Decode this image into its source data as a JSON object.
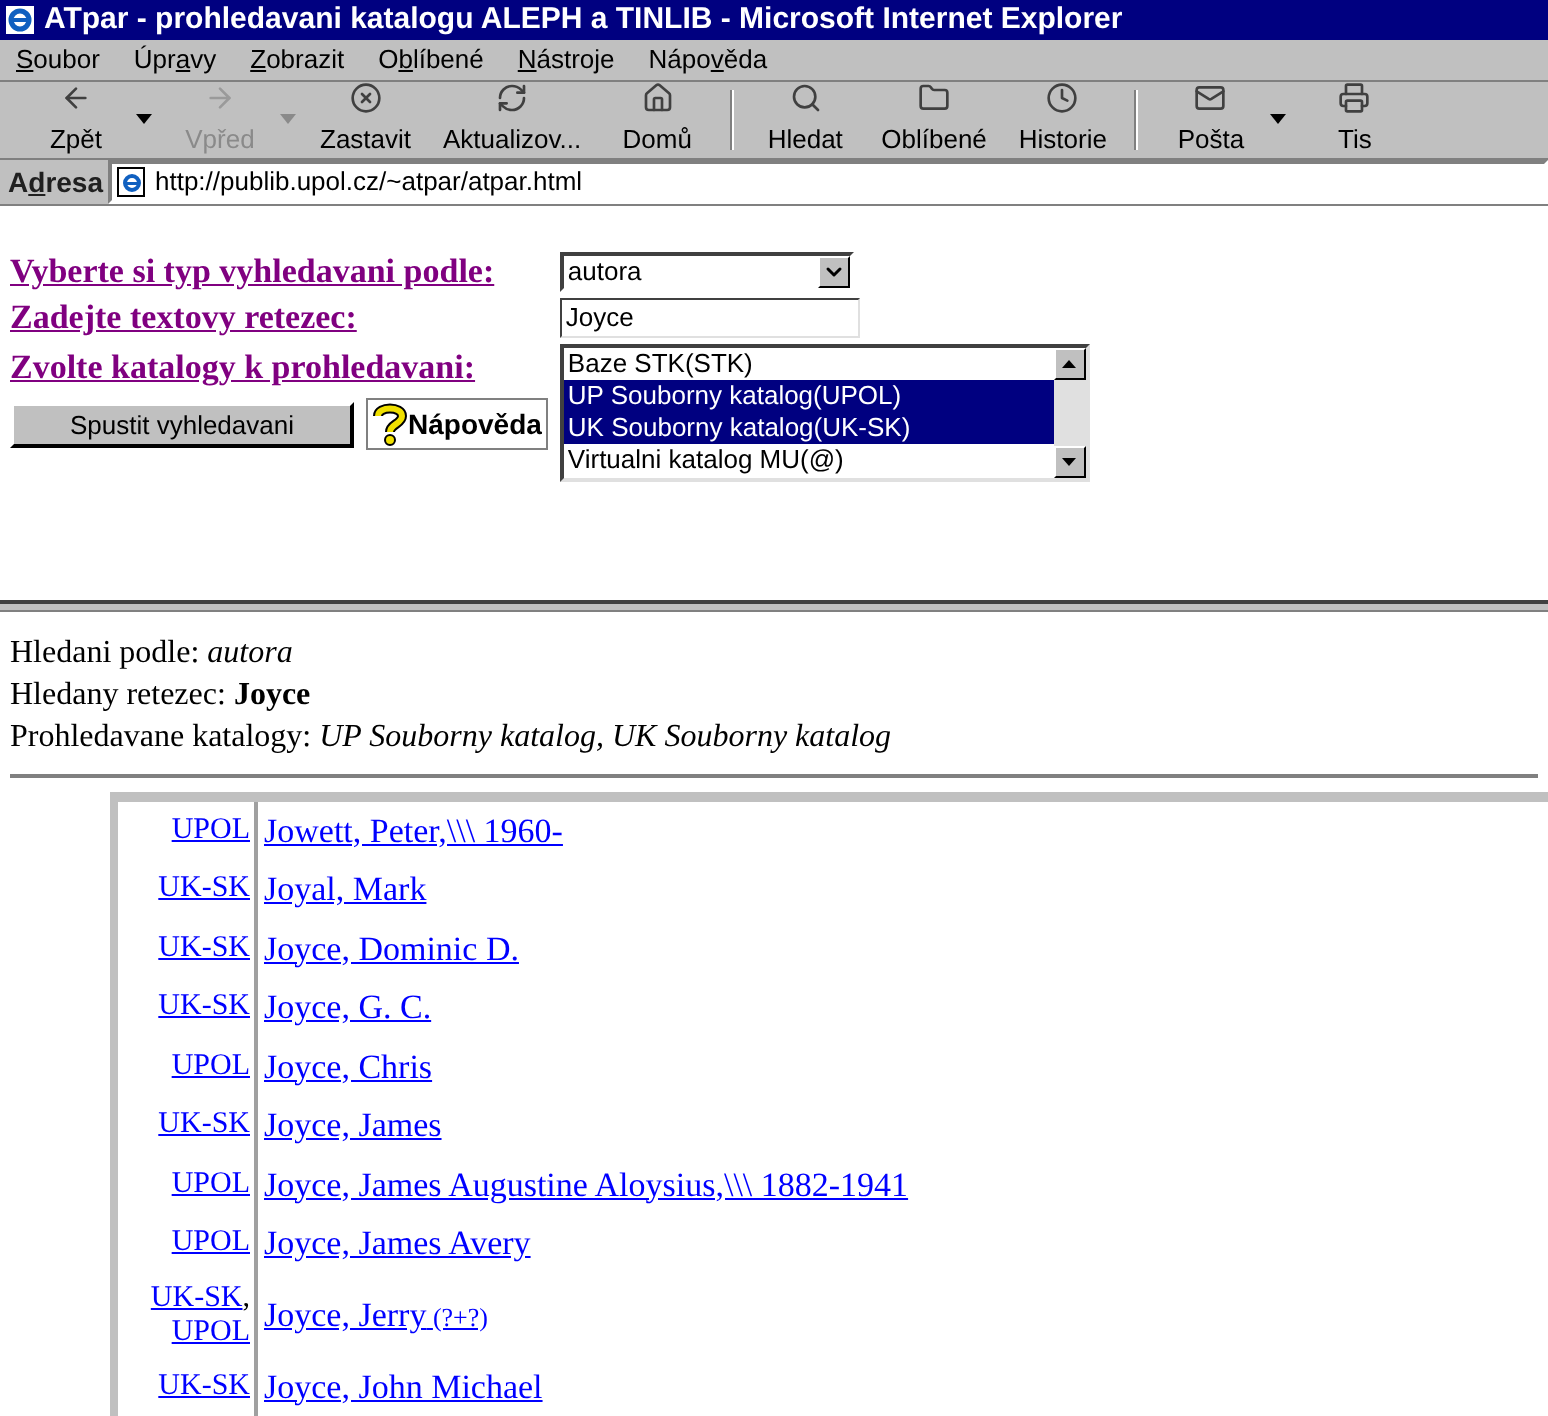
{
  "window": {
    "title": "ATpar - prohledavani katalogu ALEPH a TINLIB - Microsoft Internet Explorer"
  },
  "menu": [
    {
      "label": "Soubor"
    },
    {
      "label": "Úpravy"
    },
    {
      "label": "Zobrazit"
    },
    {
      "label": "Oblíbené"
    },
    {
      "label": "Nástroje"
    },
    {
      "label": "Nápověda"
    }
  ],
  "toolbar": [
    {
      "kind": "back",
      "label": "Zpět",
      "disabled": false,
      "dropdown": true
    },
    {
      "kind": "forward",
      "label": "Vpřed",
      "disabled": true,
      "dropdown": true
    },
    {
      "kind": "stop",
      "label": "Zastavit",
      "disabled": false,
      "dropdown": false
    },
    {
      "kind": "refresh",
      "label": "Aktualizov...",
      "disabled": false,
      "dropdown": false
    },
    {
      "kind": "home",
      "label": "Domů",
      "disabled": false,
      "dropdown": false
    },
    {
      "kind": "separator"
    },
    {
      "kind": "search",
      "label": "Hledat",
      "disabled": false,
      "dropdown": false
    },
    {
      "kind": "favorites",
      "label": "Oblíbené",
      "disabled": false,
      "dropdown": false
    },
    {
      "kind": "history",
      "label": "Historie",
      "disabled": false,
      "dropdown": false
    },
    {
      "kind": "separator"
    },
    {
      "kind": "mail",
      "label": "Pošta",
      "disabled": false,
      "dropdown": true
    },
    {
      "kind": "print",
      "label": "Tis",
      "disabled": false,
      "dropdown": false
    }
  ],
  "address_bar": {
    "label": "Adresa",
    "value": "http://publib.upol.cz/~atpar/atpar.html"
  },
  "form": {
    "search_type_label": "Vyberte si typ vyhledavani podle:",
    "search_type_value": "autora",
    "text_label": "Zadejte textovy retezec:",
    "text_value": "Joyce",
    "catalogs_label": "Zvolte katalogy k prohledavani:",
    "catalogs": [
      {
        "label": "Baze STK(STK)",
        "selected": false
      },
      {
        "label": "UP Souborny katalog(UPOL)",
        "selected": true
      },
      {
        "label": "UK Souborny katalog(UK-SK)",
        "selected": true
      },
      {
        "label": "Virtualni katalog MU(@)",
        "selected": false
      }
    ],
    "submit_button": "Spustit vyhledavani",
    "help_button": "Nápověda"
  },
  "summary": [
    {
      "label": "Hledani podle:",
      "value": "autora"
    },
    {
      "label": "Hledany retezec:",
      "value": "Joyce"
    },
    {
      "label": "Prohledavane katalogy:",
      "value": "UP Souborny katalog, UK Souborny katalog"
    }
  ],
  "results": [
    {
      "catalogs": [
        "UPOL"
      ],
      "name": "Jowett, Peter,\\\\\\ 1960-"
    },
    {
      "catalogs": [
        "UK-SK"
      ],
      "name": "Joyal, Mark"
    },
    {
      "catalogs": [
        "UK-SK"
      ],
      "name": "Joyce, Dominic D."
    },
    {
      "catalogs": [
        "UK-SK"
      ],
      "name": "Joyce, G. C."
    },
    {
      "catalogs": [
        "UPOL"
      ],
      "name": "Joyce, Chris"
    },
    {
      "catalogs": [
        "UK-SK"
      ],
      "name": "Joyce, James"
    },
    {
      "catalogs": [
        "UPOL"
      ],
      "name": "Joyce, James Augustine Aloysius,\\\\\\ 1882-1941"
    },
    {
      "catalogs": [
        "UPOL"
      ],
      "name": "Joyce, James Avery"
    },
    {
      "catalogs": [
        "UK-SK",
        "UPOL"
      ],
      "separator": ",",
      "name": "Joyce, Jerry",
      "note": "(?+?)"
    },
    {
      "catalogs": [
        "UK-SK"
      ],
      "name": "Joyce, John Michael"
    }
  ]
}
